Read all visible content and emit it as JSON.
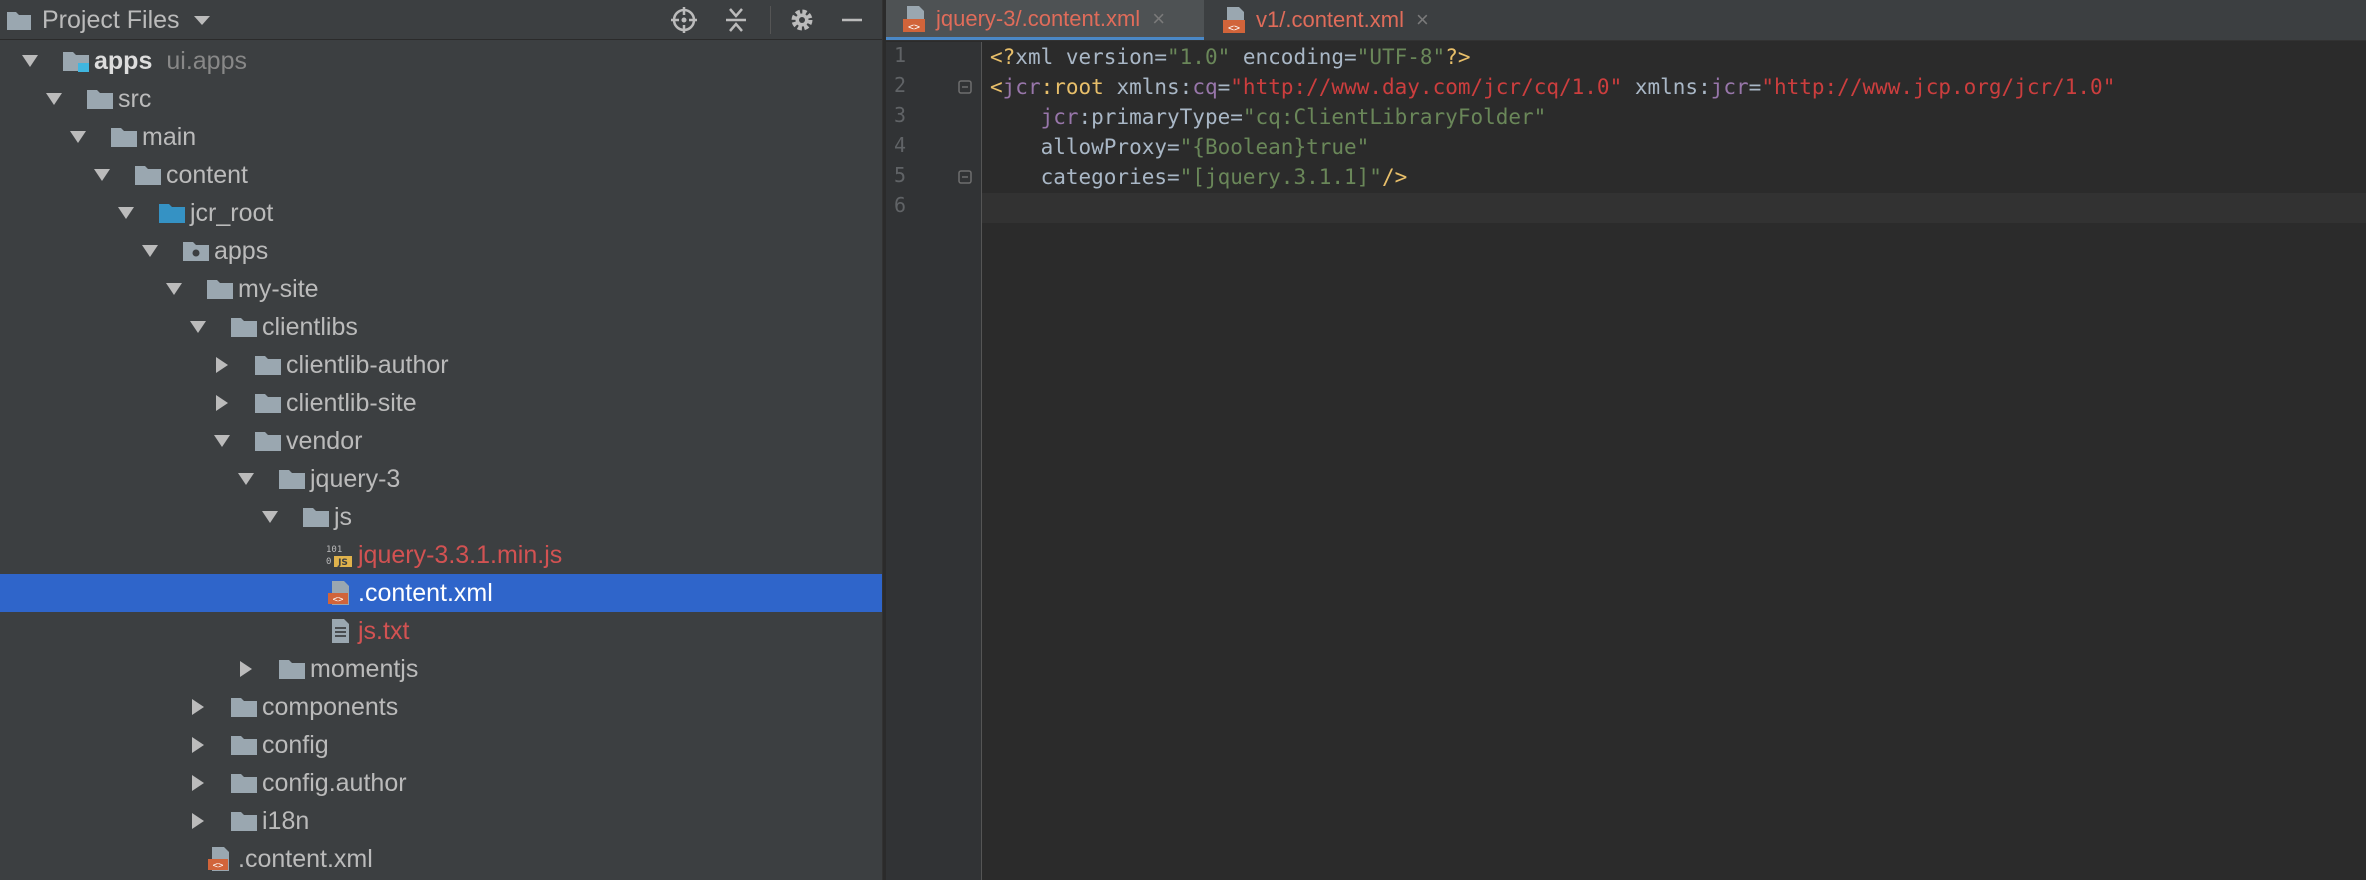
{
  "project_panel": {
    "title": "Project Files",
    "header_icons": [
      "folder-icon",
      "chevron-down-icon",
      "locate-icon",
      "collapse-icon",
      "gear-icon",
      "minimize-icon"
    ],
    "tree": [
      {
        "label": "apps",
        "sub": "ui.apps",
        "expanded": true,
        "icon": "module-folder"
      },
      {
        "label": "src",
        "expanded": true,
        "icon": "folder"
      },
      {
        "label": "main",
        "expanded": true,
        "icon": "folder"
      },
      {
        "label": "content",
        "expanded": true,
        "icon": "folder"
      },
      {
        "label": "jcr_root",
        "expanded": true,
        "icon": "source-folder"
      },
      {
        "label": "apps",
        "expanded": true,
        "icon": "package-folder"
      },
      {
        "label": "my-site",
        "expanded": true,
        "icon": "folder"
      },
      {
        "label": "clientlibs",
        "expanded": true,
        "icon": "folder"
      },
      {
        "label": "clientlib-author",
        "expanded": false,
        "icon": "folder"
      },
      {
        "label": "clientlib-site",
        "expanded": false,
        "icon": "folder"
      },
      {
        "label": "vendor",
        "expanded": true,
        "icon": "folder"
      },
      {
        "label": "jquery-3",
        "expanded": true,
        "icon": "folder"
      },
      {
        "label": "js",
        "expanded": true,
        "icon": "folder"
      },
      {
        "label": "jquery-3.3.1.min.js",
        "icon": "js-file"
      },
      {
        "label": ".content.xml",
        "icon": "xml-file",
        "selected": true
      },
      {
        "label": "js.txt",
        "icon": "text-file"
      },
      {
        "label": "momentjs",
        "expanded": false,
        "icon": "folder"
      },
      {
        "label": "components",
        "expanded": false,
        "icon": "folder"
      },
      {
        "label": "config",
        "expanded": false,
        "icon": "folder"
      },
      {
        "label": "config.author",
        "expanded": false,
        "icon": "folder"
      },
      {
        "label": "i18n",
        "expanded": false,
        "icon": "folder"
      },
      {
        "label": ".content.xml",
        "icon": "xml-file"
      }
    ]
  },
  "editor": {
    "tabs": [
      {
        "label": "jquery-3/.content.xml",
        "close": "×",
        "active": true
      },
      {
        "label": "v1/.content.xml",
        "close": "×",
        "active": false
      }
    ],
    "line_numbers": [
      "1",
      "2",
      "3",
      "4",
      "5",
      "6"
    ],
    "lines": [
      [
        {
          "t": "<?",
          "c": "kw"
        },
        {
          "t": "xml version=",
          "c": "def"
        },
        {
          "t": "\"1.0\"",
          "c": "str"
        },
        {
          "t": " encoding=",
          "c": "def"
        },
        {
          "t": "\"UTF-8\"",
          "c": "str"
        },
        {
          "t": "?>",
          "c": "kw"
        }
      ],
      [
        {
          "t": "<",
          "c": "kw"
        },
        {
          "t": "jcr",
          "c": "ns"
        },
        {
          "t": ":root",
          "c": "kw"
        },
        {
          "t": " xmlns:",
          "c": "def"
        },
        {
          "t": "cq",
          "c": "ns"
        },
        {
          "t": "=",
          "c": "def"
        },
        {
          "t": "\"http://www.day.com/jcr/cq/1.0\"",
          "c": "url"
        },
        {
          "t": " xmlns:",
          "c": "def"
        },
        {
          "t": "jcr",
          "c": "ns"
        },
        {
          "t": "=",
          "c": "def"
        },
        {
          "t": "\"http://www.jcp.org/jcr/1.0\"",
          "c": "url"
        }
      ],
      [
        {
          "t": "    ",
          "c": "def"
        },
        {
          "t": "jcr",
          "c": "ns"
        },
        {
          "t": ":primaryType=",
          "c": "def"
        },
        {
          "t": "\"cq:ClientLibraryFolder\"",
          "c": "str"
        }
      ],
      [
        {
          "t": "    allowProxy=",
          "c": "def"
        },
        {
          "t": "\"{Boolean}true\"",
          "c": "str"
        }
      ],
      [
        {
          "t": "    categories=",
          "c": "def"
        },
        {
          "t": "\"[jquery.3.1.1]\"",
          "c": "str"
        },
        {
          "t": "/>",
          "c": "kw"
        }
      ],
      []
    ]
  },
  "colors": {
    "panel_bg": "#3c3f41",
    "editor_bg": "#2b2b2b",
    "selection": "#2f65ca",
    "tag": "#e8bf6a",
    "namespace": "#9876aa",
    "string": "#6a8759",
    "url": "#cc3e3e",
    "vcs_modified": "#d25252"
  }
}
